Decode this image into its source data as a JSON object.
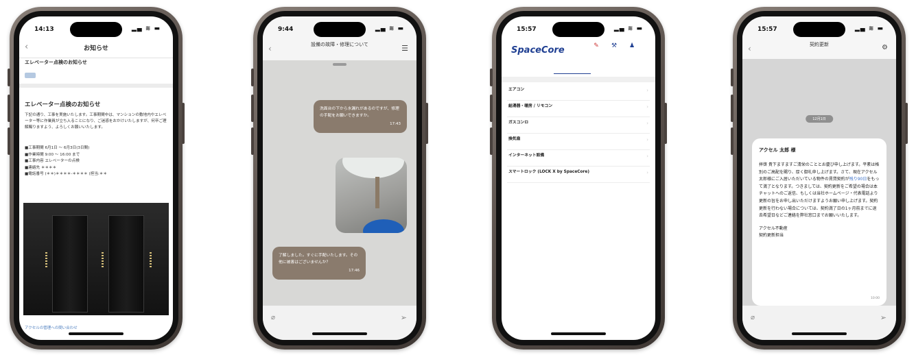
{
  "phones": [
    {
      "time": "14:13",
      "title": "お知らせ",
      "subtitle": "エレベーター点検のお知らせ",
      "tag": "",
      "heading": "エレベーター点検のお知らせ",
      "body": "下記の通り、工事を実施いたします。工事期間中は、マンションの敷地内やエレベーター等に作業員が立ち入ることになり、ご迷惑をおかけいたしますが、何卒ご理解賜りますよう、よろしくお願いいたします。",
      "list": [
        "■工事期間 6月1日 〜 6月3日(3日間)",
        "■作業時間 9:00 〜 16:00 まで",
        "■工事内容 エレベーターの点検",
        "■連絡先 ＊＊＊＊",
        "■電話番号 (＊＊)＊＊＊＊-＊＊＊＊ (担当:＊＊"
      ],
      "link": "アクセルの管理への問い合わせ"
    },
    {
      "time": "9:44",
      "title": "設備の故障・修理について",
      "pill": "",
      "msg1": "洗面台の下から水漏れがあるのですが、修理の手配をお願いできますか。",
      "msg1_time": "17:43",
      "msg2": "了解しました。すぐに手配いたします。その他に被害はございませんか？",
      "msg2_time": "17:46"
    },
    {
      "time": "15:57",
      "logo": "SpaceCore",
      "rows": [
        {
          "name": "エアコン"
        },
        {
          "name": "給湯器・暖房 / リモコン"
        },
        {
          "name": "ガスコンロ"
        },
        {
          "name": "換気扇"
        },
        {
          "name": "インターネット設備"
        },
        {
          "name": "スマートロック (LOCK X by SpaceCore)"
        }
      ]
    },
    {
      "time": "15:57",
      "title": "契約更新",
      "pill": "12月1日",
      "to": "アクセル 太郎 様",
      "body_a": "拝啓 貴下ますますご清栄のこととお慶び申し上げます。平素は格別のご高配を賜り、厚く御礼申し上げます。さて、現在アクセル太郎様にご入居いただいている物件の賃貸契約が",
      "body_link": "残り90日",
      "body_b": "をもって満了となります。つきましては、契約更新をご希望の場合は本チャットへのご返信、もしくは当社ホームページ・代表電話より更新の旨をお申し出いただけますようお願い申し上げます。契約更新を行わない場合については、契約満了日の1ヶ月前までに退去希望日などご連絡を弊社窓口までお願いいたします。",
      "sig1": "アクセル不動産",
      "sig2": "契約更新担当",
      "msg_time": "10:00"
    }
  ]
}
